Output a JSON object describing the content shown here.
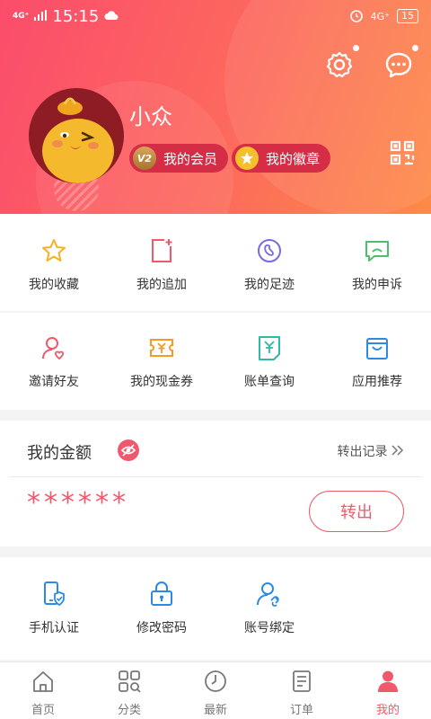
{
  "status_bar": {
    "network": "4G⁺",
    "time": "15:15",
    "net_right": "4G⁺",
    "battery": "15"
  },
  "profile": {
    "name": "小众",
    "member_badge": "V2",
    "member_label": "我的会员",
    "badge_label": "我的徽章"
  },
  "row1": [
    {
      "label": "我的收藏",
      "icon": "star-icon",
      "color": "#f5b221"
    },
    {
      "label": "我的追加",
      "icon": "add-doc-icon",
      "color": "#f0596c"
    },
    {
      "label": "我的足迹",
      "icon": "footprint-icon",
      "color": "#7a6ae0"
    },
    {
      "label": "我的申诉",
      "icon": "complaint-icon",
      "color": "#49c16b"
    }
  ],
  "row2": [
    {
      "label": "邀请好友",
      "icon": "invite-icon",
      "color": "#f0596c"
    },
    {
      "label": "我的现金券",
      "icon": "coupon-icon",
      "color": "#f59a23"
    },
    {
      "label": "账单查询",
      "icon": "bill-icon",
      "color": "#2fb9a6"
    },
    {
      "label": "应用推荐",
      "icon": "bag-icon",
      "color": "#2b8ae6"
    }
  ],
  "balance": {
    "title": "我的金额",
    "link": "转出记录",
    "amount": "******",
    "button": "转出"
  },
  "row3": [
    {
      "label": "手机认证",
      "icon": "phone-verify-icon",
      "color": "#2b8ae6"
    },
    {
      "label": "修改密码",
      "icon": "lock-icon",
      "color": "#2b8ae6"
    },
    {
      "label": "账号绑定",
      "icon": "account-bind-icon",
      "color": "#2b8ae6"
    }
  ],
  "tabs": [
    {
      "label": "首页",
      "icon": "home-icon",
      "active": false
    },
    {
      "label": "分类",
      "icon": "category-icon",
      "active": false
    },
    {
      "label": "最新",
      "icon": "clock-icon",
      "active": false
    },
    {
      "label": "订单",
      "icon": "order-icon",
      "active": false
    },
    {
      "label": "我的",
      "icon": "person-icon",
      "active": true
    }
  ],
  "colors": {
    "accent": "#f0596c",
    "header_start": "#fb4c6c",
    "header_end": "#fd8a47"
  }
}
